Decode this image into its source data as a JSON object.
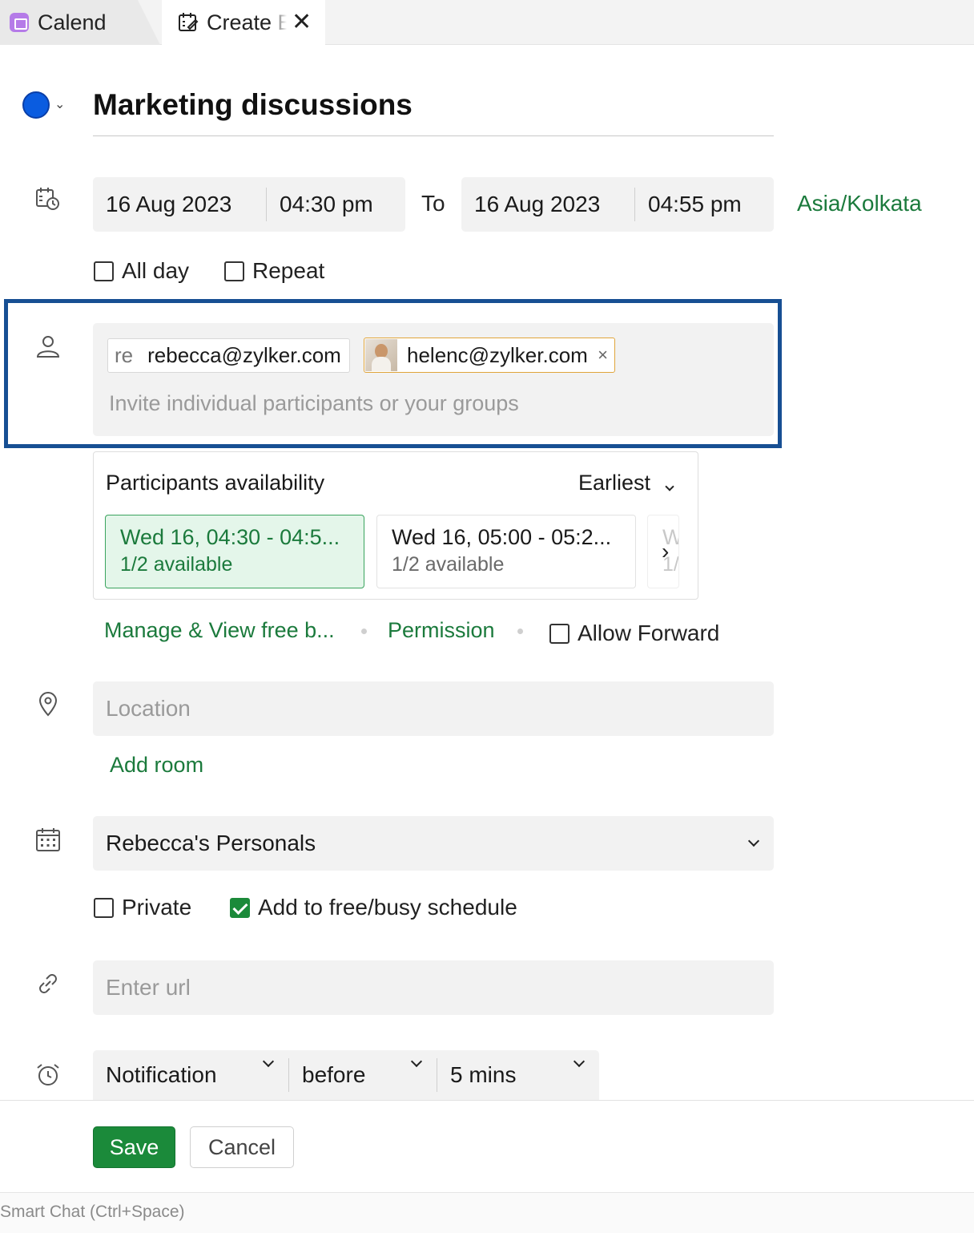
{
  "tabs": [
    {
      "label": "Calend"
    },
    {
      "label": "Create Event"
    }
  ],
  "event": {
    "title": "Marketing discussions",
    "color": "#0a5ce0"
  },
  "datetime": {
    "start_date": "16 Aug 2023",
    "start_time": "04:30 pm",
    "to_label": "To",
    "end_date": "16 Aug 2023",
    "end_time": "04:55 pm",
    "timezone": "Asia/Kolkata",
    "all_day_label": "All day",
    "repeat_label": "Repeat"
  },
  "participants": {
    "chips": [
      {
        "initials": "re",
        "email": "rebecca@zylker.com"
      },
      {
        "email": "helenc@zylker.com",
        "remove": "×"
      }
    ],
    "placeholder": "Invite individual participants or your groups"
  },
  "availability": {
    "title": "Participants availability",
    "sort_label": "Earliest",
    "slots": [
      {
        "time": "Wed 16, 04:30 - 04:5...",
        "status": "1/2 available",
        "selected": true
      },
      {
        "time": "Wed 16, 05:00 - 05:2...",
        "status": "1/2 available",
        "selected": false
      },
      {
        "time": "W",
        "status": "1/",
        "selected": false
      }
    ]
  },
  "links": {
    "manage": "Manage & View free b...",
    "permission": "Permission",
    "allow_forward": "Allow Forward"
  },
  "location": {
    "placeholder": "Location",
    "add_room": "Add room"
  },
  "calendar": {
    "selected": "Rebecca's Personals"
  },
  "options": {
    "private_label": "Private",
    "private_checked": false,
    "freebusy_label": "Add to free/busy schedule",
    "freebusy_checked": true
  },
  "url": {
    "placeholder": "Enter url"
  },
  "reminder": {
    "type": "Notification",
    "when": "before",
    "duration": "5 mins"
  },
  "actions": {
    "save": "Save",
    "cancel": "Cancel"
  },
  "footer": {
    "smart_chat": "Smart Chat (Ctrl+Space)"
  },
  "colors": {
    "accent_green": "#1b8a3a",
    "highlight_blue": "#174f93"
  }
}
